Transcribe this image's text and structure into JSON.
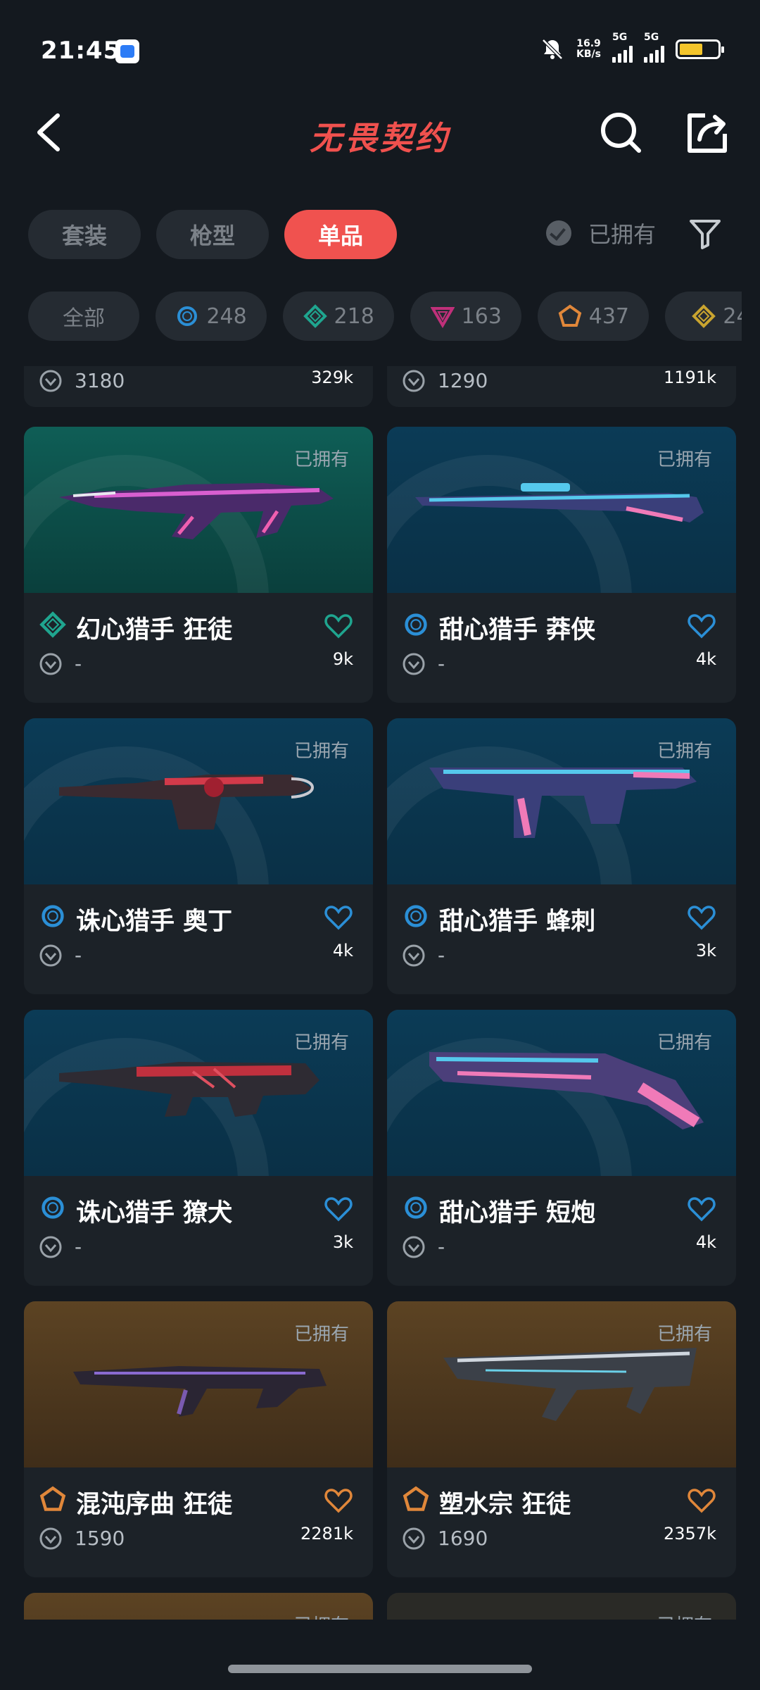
{
  "status_bar": {
    "time": "21:45",
    "net_speed_value": "16.9",
    "net_speed_unit": "KB/s",
    "signal1_label": "5G",
    "signal2_label": "5G",
    "icons": [
      "app-notification-icon",
      "mute-bell-icon",
      "signal-icon",
      "battery-icon"
    ]
  },
  "header": {
    "brand": "无畏契约",
    "icons": [
      "back-icon",
      "search-icon",
      "share-icon"
    ]
  },
  "tabs": [
    {
      "label": "套装",
      "active": false
    },
    {
      "label": "枪型",
      "active": false
    },
    {
      "label": "单品",
      "active": true
    }
  ],
  "owned_filter_label": "已拥有",
  "rarity_chips": [
    {
      "label": "全部",
      "icon": "",
      "color": ""
    },
    {
      "label": "248",
      "icon": "ring-icon",
      "color": "#2b8fd6"
    },
    {
      "label": "218",
      "icon": "diamond-icon",
      "color": "#1fa58f"
    },
    {
      "label": "163",
      "icon": "triangle-icon",
      "color": "#c0307a"
    },
    {
      "label": "437",
      "icon": "pentagon-icon",
      "color": "#e0873a"
    },
    {
      "label": "24",
      "icon": "diamond-icon",
      "color": "#c9a42f"
    }
  ],
  "top_partial": [
    {
      "price": "3180",
      "likes": "329k"
    },
    {
      "price": "1290",
      "likes": "1191k"
    }
  ],
  "items": [
    {
      "name": "幻心猎手 狂徒",
      "owned": "已拥有",
      "price": "-",
      "likes": "9k",
      "rarity_icon": "diamond-icon",
      "accent": "#1fa58f",
      "bg": "green"
    },
    {
      "name": "甜心猎手 莽侠",
      "owned": "已拥有",
      "price": "-",
      "likes": "4k",
      "rarity_icon": "ring-icon",
      "accent": "#2b8fd6",
      "bg": "blue"
    },
    {
      "name": "诛心猎手 奥丁",
      "owned": "已拥有",
      "price": "-",
      "likes": "4k",
      "rarity_icon": "ring-icon",
      "accent": "#2b8fd6",
      "bg": "blue"
    },
    {
      "name": "甜心猎手 蜂刺",
      "owned": "已拥有",
      "price": "-",
      "likes": "3k",
      "rarity_icon": "ring-icon",
      "accent": "#2b8fd6",
      "bg": "blue"
    },
    {
      "name": "诛心猎手 獠犬",
      "owned": "已拥有",
      "price": "-",
      "likes": "3k",
      "rarity_icon": "ring-icon",
      "accent": "#2b8fd6",
      "bg": "blue"
    },
    {
      "name": "甜心猎手 短炮",
      "owned": "已拥有",
      "price": "-",
      "likes": "4k",
      "rarity_icon": "ring-icon",
      "accent": "#2b8fd6",
      "bg": "blue"
    },
    {
      "name": "混沌序曲 狂徒",
      "owned": "已拥有",
      "price": "1590",
      "likes": "2281k",
      "rarity_icon": "pentagon-icon",
      "accent": "#e0873a",
      "bg": "gold"
    },
    {
      "name": "塑水宗 狂徒",
      "owned": "已拥有",
      "price": "1690",
      "likes": "2357k",
      "rarity_icon": "pentagon-icon",
      "accent": "#e0873a",
      "bg": "gold"
    }
  ],
  "bottom_partial": [
    {
      "owned": "已拥有"
    },
    {
      "owned": "已拥有"
    }
  ],
  "colors": {
    "background": "#14191f",
    "card": "#1c2228",
    "accent_red": "#f0524f"
  }
}
